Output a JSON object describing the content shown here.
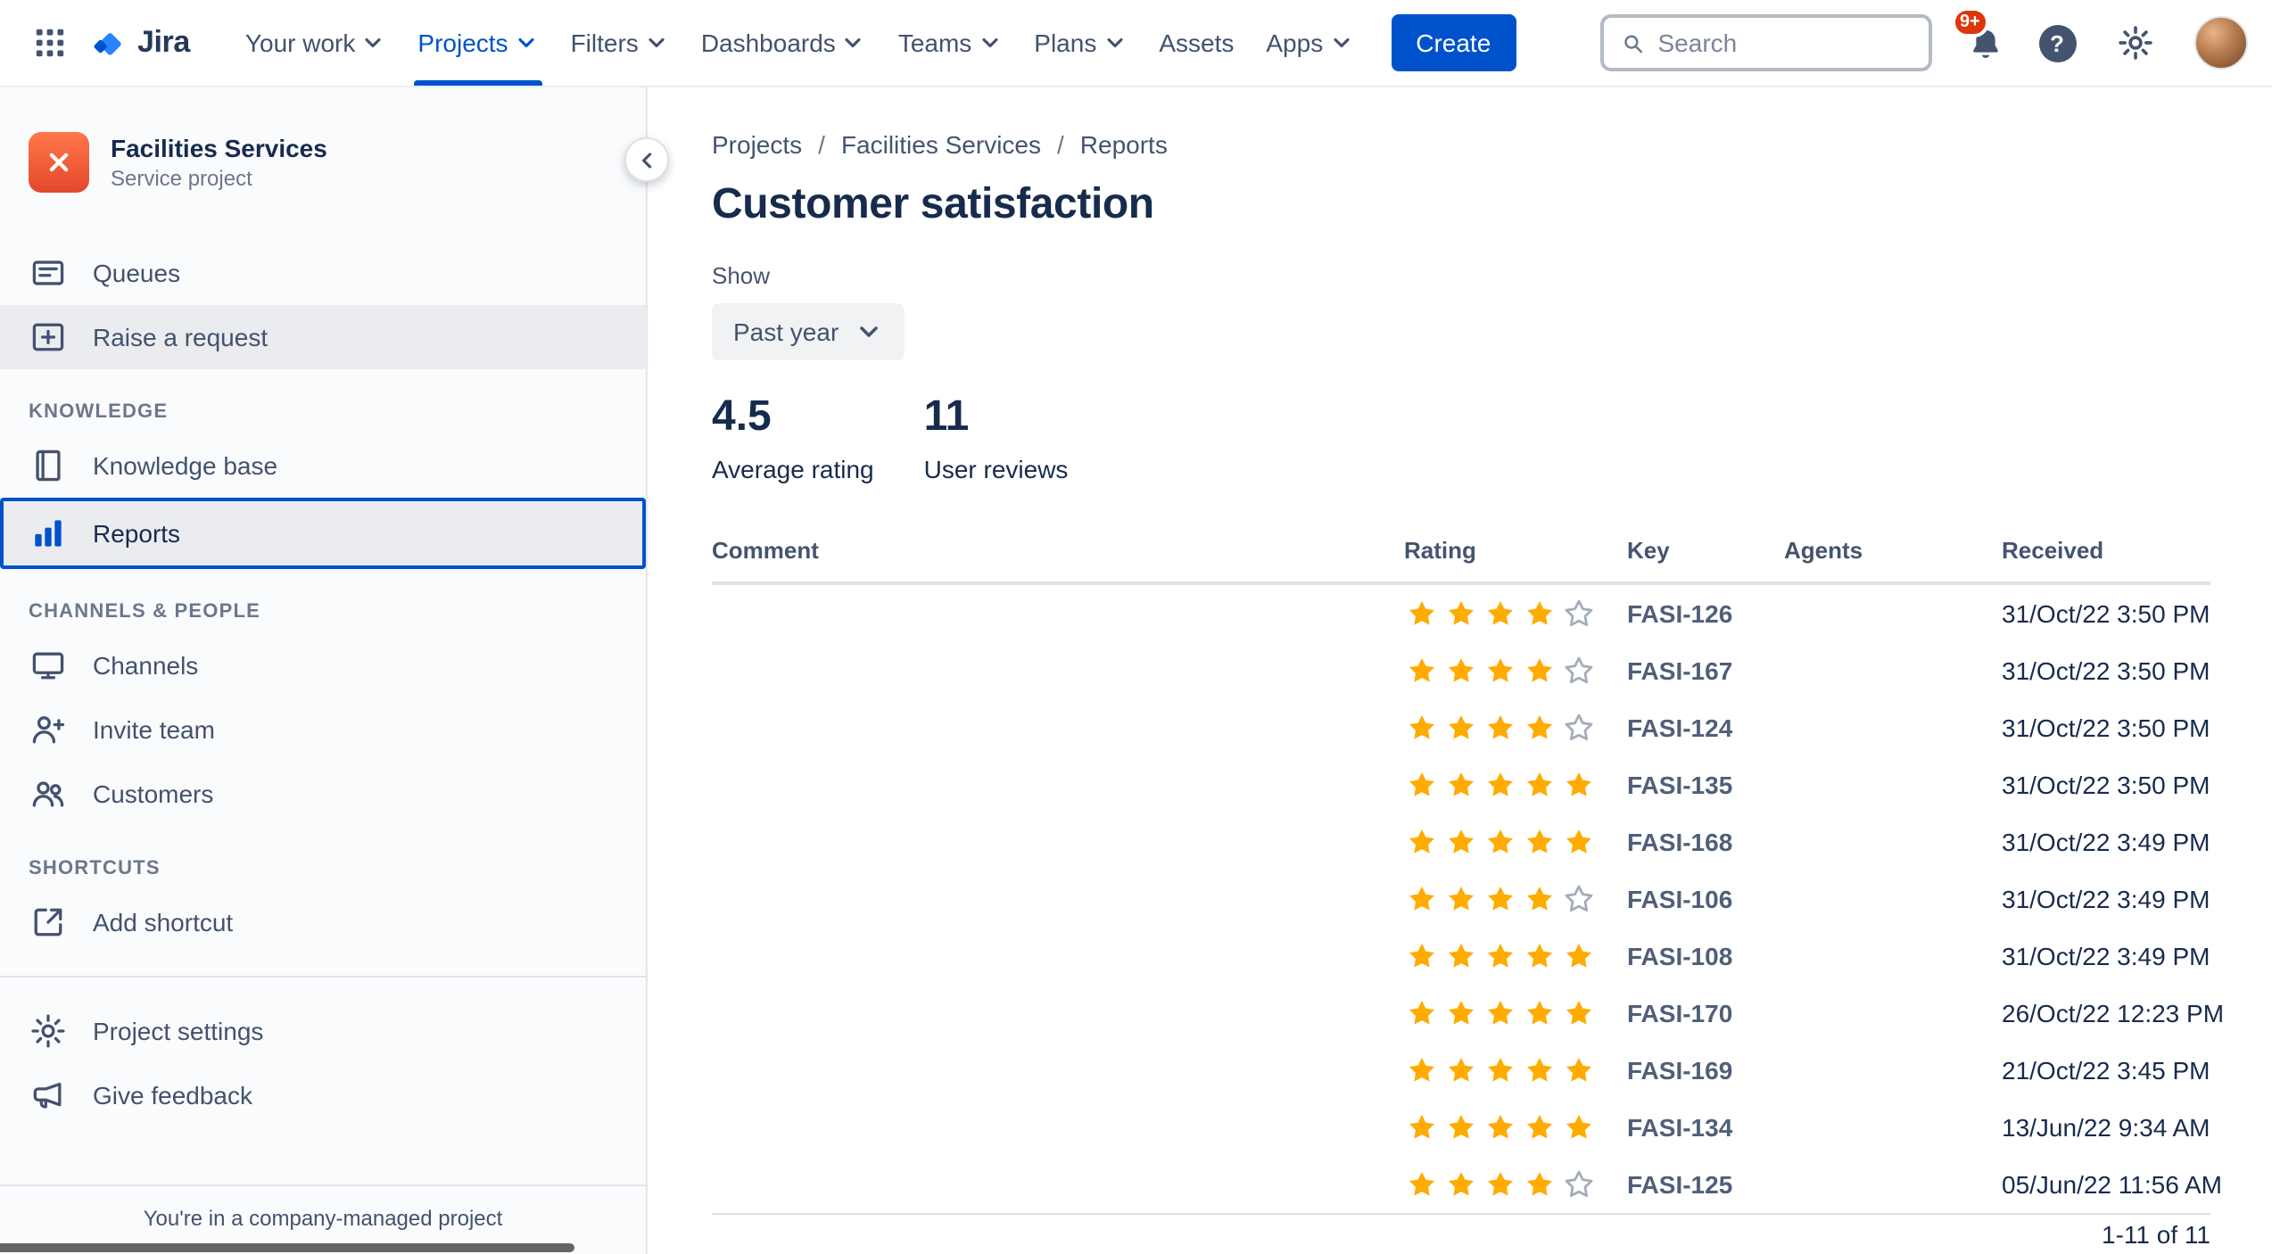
{
  "navbar": {
    "logo_text": "Jira",
    "help_glyph": "?",
    "items": [
      {
        "label": "Your work",
        "chevron": true,
        "active": false
      },
      {
        "label": "Projects",
        "chevron": true,
        "active": true
      },
      {
        "label": "Filters",
        "chevron": true,
        "active": false
      },
      {
        "label": "Dashboards",
        "chevron": true,
        "active": false
      },
      {
        "label": "Teams",
        "chevron": true,
        "active": false
      },
      {
        "label": "Plans",
        "chevron": true,
        "active": false
      },
      {
        "label": "Assets",
        "chevron": false,
        "active": false
      },
      {
        "label": "Apps",
        "chevron": true,
        "active": false
      }
    ],
    "create_button": "Create",
    "search": {
      "placeholder": "Search"
    },
    "notification_badge": "9+"
  },
  "sidebar": {
    "project": {
      "name": "Facilities Services",
      "type": "Service project"
    },
    "groups": [
      {
        "title": null,
        "items": [
          {
            "label": "Queues",
            "icon": "queues-icon"
          },
          {
            "label": "Raise a request",
            "icon": "raise-request-icon",
            "highlighted": true
          }
        ]
      },
      {
        "title": "KNOWLEDGE",
        "items": [
          {
            "label": "Knowledge base",
            "icon": "book-icon"
          },
          {
            "label": "Reports",
            "icon": "bar-chart-icon",
            "selected": true
          }
        ]
      },
      {
        "title": "CHANNELS & PEOPLE",
        "items": [
          {
            "label": "Channels",
            "icon": "monitor-icon"
          },
          {
            "label": "Invite team",
            "icon": "invite-icon"
          },
          {
            "label": "Customers",
            "icon": "people-icon"
          }
        ]
      },
      {
        "title": "SHORTCUTS",
        "items": [
          {
            "label": "Add shortcut",
            "icon": "add-shortcut-icon"
          }
        ]
      },
      {
        "title": null,
        "divider": true,
        "items": [
          {
            "label": "Project settings",
            "icon": "gear-icon"
          },
          {
            "label": "Give feedback",
            "icon": "megaphone-icon"
          }
        ]
      }
    ],
    "footer_note": "You're in a company-managed project"
  },
  "main": {
    "breadcrumb": [
      "Projects",
      "Facilities Services",
      "Reports"
    ],
    "breadcrumb_separator": "/",
    "title": "Customer satisfaction",
    "filter": {
      "label": "Show",
      "value": "Past year"
    },
    "stats": [
      {
        "value": "4.5",
        "label": "Average rating"
      },
      {
        "value": "11",
        "label": "User reviews"
      }
    ],
    "table": {
      "columns": [
        "Comment",
        "Rating",
        "Key",
        "Agents",
        "Received"
      ],
      "max_rating": 5,
      "rows": [
        {
          "comment": "",
          "rating": 4,
          "key": "FASI-126",
          "agents": "",
          "received": "31/Oct/22 3:50 PM"
        },
        {
          "comment": "",
          "rating": 4,
          "key": "FASI-167",
          "agents": "",
          "received": "31/Oct/22 3:50 PM"
        },
        {
          "comment": "",
          "rating": 4,
          "key": "FASI-124",
          "agents": "",
          "received": "31/Oct/22 3:50 PM"
        },
        {
          "comment": "",
          "rating": 5,
          "key": "FASI-135",
          "agents": "",
          "received": "31/Oct/22 3:50 PM"
        },
        {
          "comment": "",
          "rating": 5,
          "key": "FASI-168",
          "agents": "",
          "received": "31/Oct/22 3:49 PM"
        },
        {
          "comment": "",
          "rating": 4,
          "key": "FASI-106",
          "agents": "",
          "received": "31/Oct/22 3:49 PM"
        },
        {
          "comment": "",
          "rating": 5,
          "key": "FASI-108",
          "agents": "",
          "received": "31/Oct/22 3:49 PM"
        },
        {
          "comment": "",
          "rating": 5,
          "key": "FASI-170",
          "agents": "",
          "received": "26/Oct/22 12:23 PM"
        },
        {
          "comment": "",
          "rating": 5,
          "key": "FASI-169",
          "agents": "",
          "received": "21/Oct/22 3:45 PM"
        },
        {
          "comment": "",
          "rating": 5,
          "key": "FASI-134",
          "agents": "",
          "received": "13/Jun/22 9:34 AM"
        },
        {
          "comment": "",
          "rating": 4,
          "key": "FASI-125",
          "agents": "",
          "received": "05/Jun/22 11:56 AM"
        }
      ],
      "pagination": "1-11 of 11"
    }
  },
  "colors": {
    "brand": "#0052CC",
    "star_filled": "#FFAB00",
    "star_empty_outline": "#A5ADBA",
    "notification_badge": "#DE350B",
    "text_dark": "#172B4D",
    "text_muted": "#6B778C",
    "sidebar_bg": "#FAFBFC"
  }
}
